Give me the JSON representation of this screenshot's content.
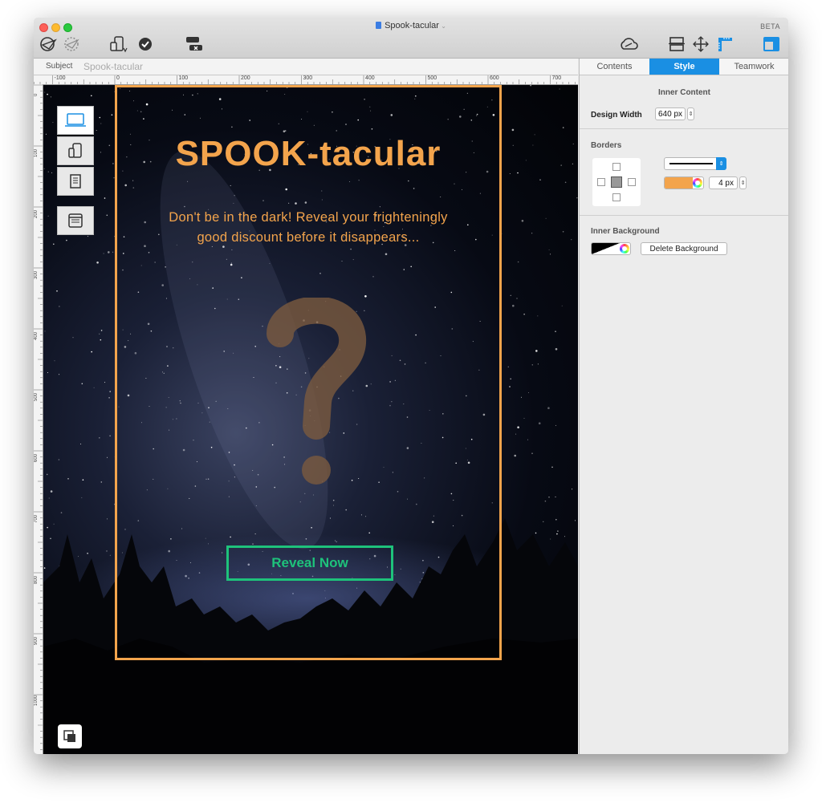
{
  "window": {
    "title": "Spook-tacular",
    "badge": "BETA"
  },
  "toolbar": {
    "left_icons": [
      "paper-plane-icon",
      "loading-plane-icon",
      "device-check-icon",
      "checkmark-circle-icon",
      "workflow-icon"
    ],
    "right_icons": [
      "cloud-icon",
      "layout-icon",
      "move-icon",
      "ruler-corner-icon",
      "sidebar-toggle-icon"
    ]
  },
  "subject": {
    "label": "Subject",
    "value": "Spook-tacular"
  },
  "ruler": {
    "h_labels": [
      "-100",
      "0",
      "100",
      "200",
      "300",
      "400",
      "500",
      "600",
      "700"
    ],
    "v_labels": [
      "0",
      "100",
      "200",
      "300",
      "400",
      "500",
      "600",
      "700",
      "800",
      "900",
      "1000"
    ]
  },
  "preview_devices": [
    "laptop-icon",
    "phone-tablet-icon",
    "document-icon",
    "browser-window-icon"
  ],
  "email": {
    "title": "SPOOK-tacular",
    "subtitle_line1": "Don't be in the dark! Reveal your frighteningly",
    "subtitle_line2": "good discount before it disappears...",
    "button": "Reveal Now"
  },
  "panel": {
    "tabs": [
      "Contents",
      "Style",
      "Teamwork"
    ],
    "active_tab": "Style",
    "inner_content": {
      "heading": "Inner Content",
      "design_width_label": "Design Width",
      "design_width_value": "640 px"
    },
    "borders": {
      "heading": "Borders",
      "color": "#f3a44c",
      "width": "4 px"
    },
    "inner_background": {
      "heading": "Inner Background",
      "delete_label": "Delete Background"
    }
  },
  "colors": {
    "accent": "#1a8fe3",
    "orange": "#f3a44c",
    "green": "#1ec27b"
  }
}
